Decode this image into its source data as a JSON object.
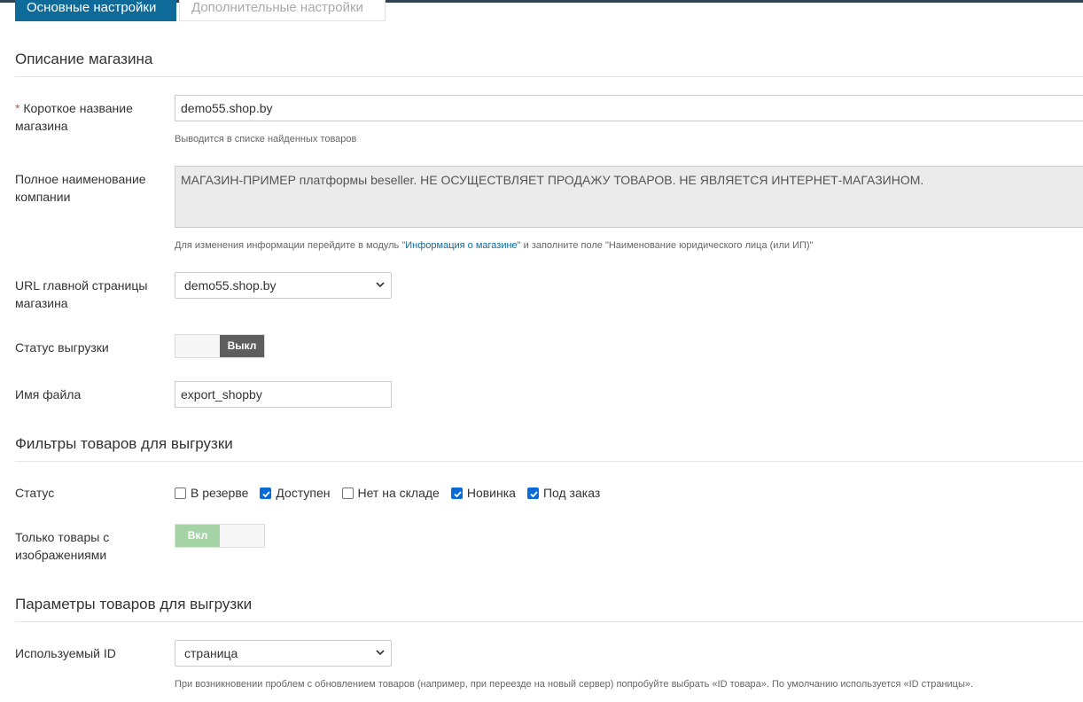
{
  "tabs": [
    {
      "label": "Основные настройки",
      "active": true
    },
    {
      "label": "Дополнительные настройки",
      "active": false
    }
  ],
  "sections": {
    "store": "Описание магазина",
    "filters": "Фильтры товаров для выгрузки",
    "params": "Параметры товаров для выгрузки"
  },
  "fields": {
    "short_name": {
      "required_mark": "*",
      "label": "Короткое название магазина",
      "value": "demo55.shop.by",
      "hint": "Выводится в списке найденных товаров"
    },
    "full_name": {
      "label": "Полное наименование компании",
      "value": "МАГАЗИН-ПРИМЕР платформы beseller. НЕ ОСУЩЕСТВЛЯЕТ ПРОДАЖУ ТОВАРОВ. НЕ ЯВЛЯЕТСЯ ИНТЕРНЕТ-МАГАЗИНОМ.",
      "hint_before": "Для изменения информации перейдите в модуль \"",
      "hint_link": "Информация о магазине",
      "hint_after": "\" и заполните поле \"Наименование юридического лица (или ИП)\""
    },
    "url": {
      "label": "URL главной страницы магазина",
      "value": "demo55.shop.by"
    },
    "export_status": {
      "label": "Статус выгрузки",
      "state_label": "Выкл",
      "on": false
    },
    "file_name": {
      "label": "Имя файла",
      "value": "export_shopby"
    },
    "status": {
      "label": "Статус",
      "options": [
        {
          "label": "В резерве",
          "checked": false
        },
        {
          "label": "Доступен",
          "checked": true
        },
        {
          "label": "Нет на складе",
          "checked": false
        },
        {
          "label": "Новинка",
          "checked": true
        },
        {
          "label": "Под заказ",
          "checked": true
        }
      ]
    },
    "images_only": {
      "label": "Только товары с изображениями",
      "state_label": "Вкл",
      "on": true
    },
    "used_id": {
      "label": "Используемый ID",
      "value": "страница",
      "hint": "При возникновении проблем с обновлением товаров (например, при переезде на новый сервер) попробуйте выбрать «ID товара». По умолчанию используется «ID страницы»."
    }
  },
  "colors": {
    "accent": "#0e6b99",
    "checkbox": "#0b6bd6",
    "toggle_off": "#5e5e5e",
    "toggle_on": "#a5d3a5",
    "required": "#d9534f"
  }
}
